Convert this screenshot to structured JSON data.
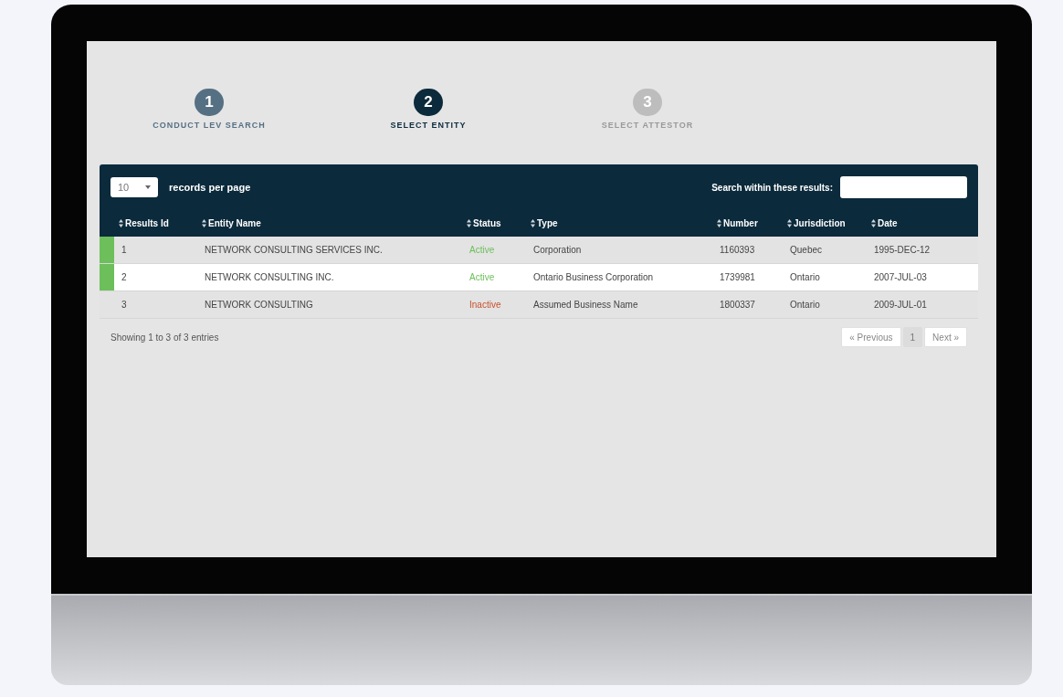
{
  "steps": [
    {
      "number": "1",
      "label": "CONDUCT LEV SEARCH",
      "completed": true,
      "selected": false
    },
    {
      "number": "2",
      "label": "SELECT ENTITY",
      "completed": false,
      "selected": true
    },
    {
      "number": "3",
      "label": "SELECT ATTESTOR",
      "completed": false,
      "selected": false
    }
  ],
  "length_menu": {
    "value": "10",
    "label": "records per page"
  },
  "search": {
    "label": "Search within these results:"
  },
  "table": {
    "columns": [
      "Results Id",
      "Entity Name",
      "Status",
      "Type",
      "Number",
      "Jurisdiction",
      "Date"
    ],
    "rows": [
      {
        "id": "1",
        "entity_name": "NETWORK CONSULTING SERVICES INC.",
        "status": "Active",
        "active": true,
        "type": "Corporation",
        "number": "1160393",
        "jurisdiction": "Quebec",
        "date": "1995-DEC-12"
      },
      {
        "id": "2",
        "entity_name": "NETWORK CONSULTING INC.",
        "status": "Active",
        "active": true,
        "type": "Ontario Business Corporation",
        "number": "1739981",
        "jurisdiction": "Ontario",
        "date": "2007-JUL-03"
      },
      {
        "id": "3",
        "entity_name": "NETWORK CONSULTING",
        "status": "Inactive",
        "active": false,
        "type": "Assumed Business Name",
        "number": "1800337",
        "jurisdiction": "Ontario",
        "date": "2009-JUL-01"
      }
    ]
  },
  "info": "Showing 1 to 3 of 3 entries",
  "pagination": [
    {
      "label": "« Previous",
      "selected": false
    },
    {
      "label": "1",
      "selected": true
    },
    {
      "label": "Next »",
      "selected": false
    }
  ]
}
